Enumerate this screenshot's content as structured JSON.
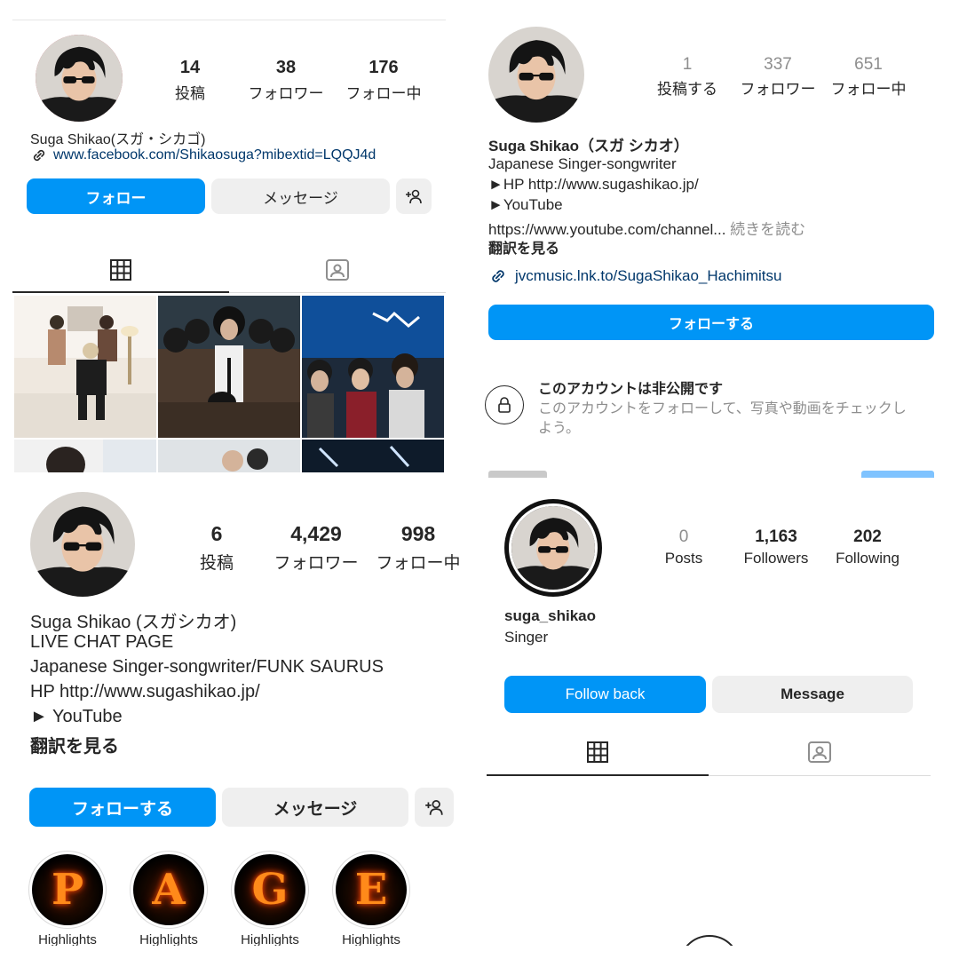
{
  "panel1": {
    "stats": [
      {
        "num": "14",
        "label": "投稿"
      },
      {
        "num": "38",
        "label": "フォロワー"
      },
      {
        "num": "176",
        "label": "フォロー中"
      }
    ],
    "name": "Suga Shikao(スガ・シカゴ)",
    "link": "www.facebook.com/Shikaosuga?mibextid=LQQJ4d",
    "follow_label": "フォロー",
    "message_label": "メッセージ",
    "grid_tab_icon": "grid-icon",
    "tagged_tab_icon": "tagged-icon"
  },
  "panel2": {
    "stats": [
      {
        "num": "1",
        "label": "投稿する"
      },
      {
        "num": "337",
        "label": "フォロワー"
      },
      {
        "num": "651",
        "label": "フォロー中"
      }
    ],
    "name": "Suga Shikao（スガ シカオ）",
    "bio": [
      "Japanese Singer-songwriter",
      "►HP http://www.sugashikao.jp/",
      "►YouTube",
      "https://www.youtube.com/channel..."
    ],
    "more": "続きを読む",
    "translate": "翻訳を見る",
    "link": "jvcmusic.lnk.to/SugaShikao_Hachimitsu",
    "follow_label": "フォローする",
    "private_title": "このアカウントは非公開です",
    "private_desc_1": "このアカウントをフォローして、写真や動画をチェックし",
    "private_desc_2": "よう。"
  },
  "panel3": {
    "stats": [
      {
        "num": "6",
        "label": "投稿"
      },
      {
        "num": "4,429",
        "label": "フォロワー"
      },
      {
        "num": "998",
        "label": "フォロー中"
      }
    ],
    "bio": [
      "Suga Shikao (スガシカオ)",
      "LIVE CHAT PAGE",
      "Japanese Singer-songwriter/FUNK SAURUS",
      "HP http://www.sugashikao.jp/",
      "► YouTube"
    ],
    "translate": "翻訳を見る",
    "follow_label": "フォローする",
    "message_label": "メッセージ",
    "highlights": [
      {
        "letter": "P",
        "label": "Highlights"
      },
      {
        "letter": "A",
        "label": "Highlights"
      },
      {
        "letter": "G",
        "label": "Highlights"
      },
      {
        "letter": "E",
        "label": "Highlights"
      }
    ]
  },
  "panel4": {
    "stats": [
      {
        "num": "0",
        "label": "Posts"
      },
      {
        "num": "1,163",
        "label": "Followers"
      },
      {
        "num": "202",
        "label": "Following"
      }
    ],
    "username": "suga_shikao",
    "bio": "Singer",
    "follow_back_label": "Follow back",
    "message_label": "Message"
  },
  "colors": {
    "accent": "#0095f6",
    "button_gray": "#efefef",
    "link": "#00376b",
    "muted": "#8e8e8e"
  }
}
